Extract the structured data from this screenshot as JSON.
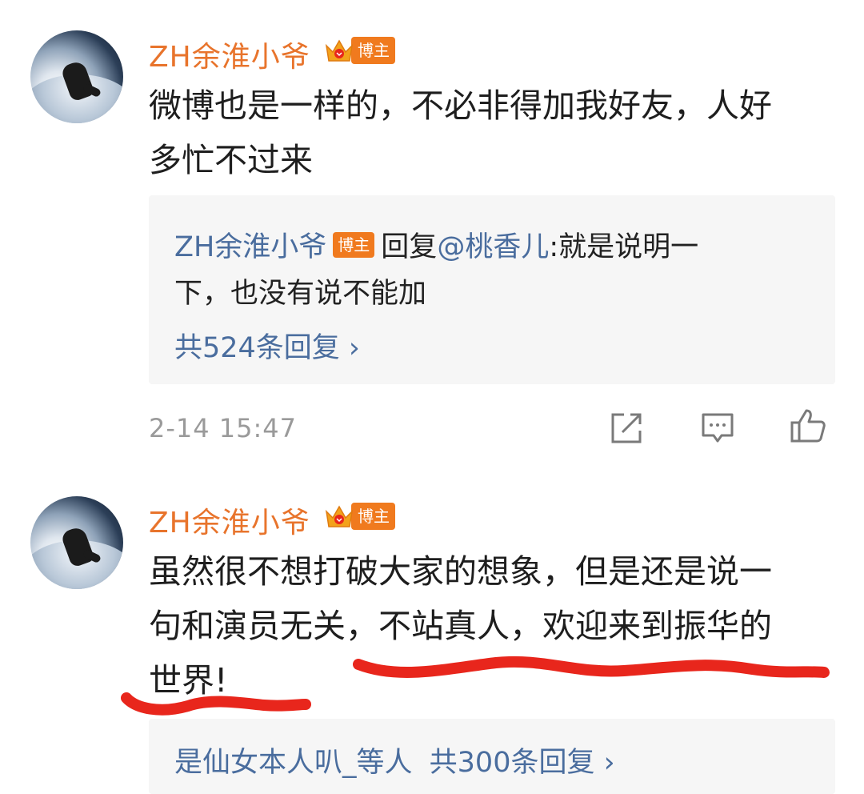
{
  "comments": [
    {
      "username": "ZH余淮小爷",
      "badge": "博主",
      "text_line1": "微博也是一样的，不必非得加我好友，人好",
      "text_line2": "多忙不过来",
      "reply": {
        "author": "ZH余淮小爷",
        "badge": "博主",
        "reply_prefix": "回复",
        "mention": "@桃香儿",
        "text_line1": ":就是说明一",
        "text_line2": "下，也没有说不能加",
        "more_link": "共524条回复 ›"
      },
      "timestamp": "2-14 15:47"
    },
    {
      "username": "ZH余淮小爷",
      "badge": "博主",
      "text_line1": "虽然很不想打破大家的想象，但是还是说一",
      "text_line2": "句和演员无关，不站真人，欢迎来到振华的",
      "text_line3": "世界!",
      "reply_summary": {
        "names": "是仙女本人叭_等人",
        "more_link": "共300条回复 ›"
      }
    }
  ],
  "icons": [
    "avatar",
    "crown-icon",
    "share-icon",
    "comment-icon",
    "like-icon"
  ],
  "colors": {
    "username": "#e8742c",
    "badge": "#f07a1e",
    "link": "#4a6d9e",
    "highlight_stroke": "#e8261c"
  }
}
